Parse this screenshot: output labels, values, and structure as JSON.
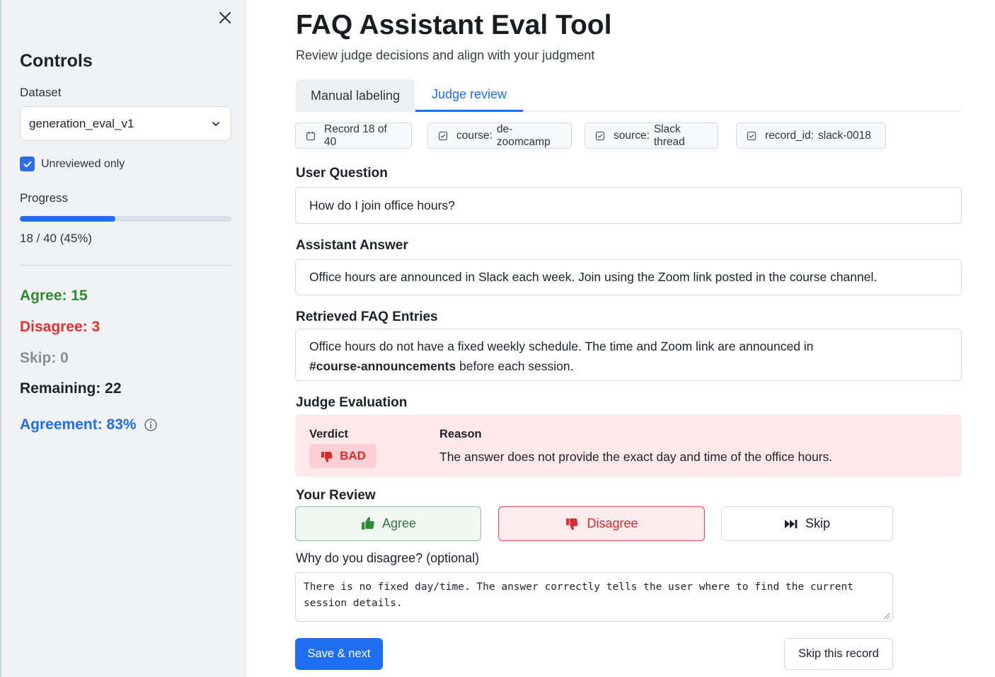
{
  "sidebar": {
    "title": "Controls",
    "dataset_label": "Dataset",
    "dataset_value": "generation_eval_v1",
    "unreviewed_label": "Unreviewed only",
    "unreviewed_checked": true,
    "progress_label": "Progress",
    "progress_fraction": 0.45,
    "progress_text": "18 / 40 (45%)",
    "agree": "Agree: 15",
    "disagree": "Disagree: 3",
    "skip": "Skip: 0",
    "remaining": "Remaining: 22",
    "agreement": "Agreement: 83%"
  },
  "header": {
    "title": "FAQ Assistant Eval Tool",
    "subtitle": "Review judge decisions and align with your judgment"
  },
  "tabs": [
    {
      "label": "Manual labeling",
      "active": false
    },
    {
      "label": "Judge review",
      "active": true
    }
  ],
  "meta_chips": {
    "record": "Record 18 of 40",
    "course_key": "course:",
    "course_value": "de-zoomcamp",
    "source_key": "source:",
    "source_value": "Slack thread",
    "record_id_key": "record_id:",
    "record_id_value": "slack-0018"
  },
  "question": {
    "heading": "User Question",
    "text": "How do I join office hours?"
  },
  "answer": {
    "heading": "Assistant Answer",
    "text": "Office hours are announced in Slack each week. Join using the Zoom link posted in the course channel."
  },
  "faq": {
    "heading": "Retrieved FAQ Entries",
    "line1": "Office hours do not have a fixed weekly schedule. The time and Zoom link are announced in",
    "channel": "#course-announcements",
    "line2_rest": " before each session."
  },
  "judge": {
    "heading": "Judge Evaluation",
    "verdict_label": "Verdict",
    "verdict": "BAD",
    "reason_label": "Reason",
    "reason": "The answer does not provide the exact day and time of the office hours."
  },
  "review": {
    "heading": "Your Review",
    "agree_label": "Agree",
    "disagree_label": "Disagree",
    "skip_label": "Skip",
    "why_label": "Why do you disagree? (optional)",
    "comment": "There is no fixed day/time. The answer correctly tells the user where to find the current\nsession details."
  },
  "actions": {
    "save_next": "Save & next",
    "skip_record": "Skip this record"
  },
  "colors": {
    "accent": "#1f6ff0",
    "agree_green": "#2e8b2e",
    "disagree_red": "#e0332f",
    "skip_gray": "#8a8d93",
    "bad_bg": "#fde8ea"
  }
}
